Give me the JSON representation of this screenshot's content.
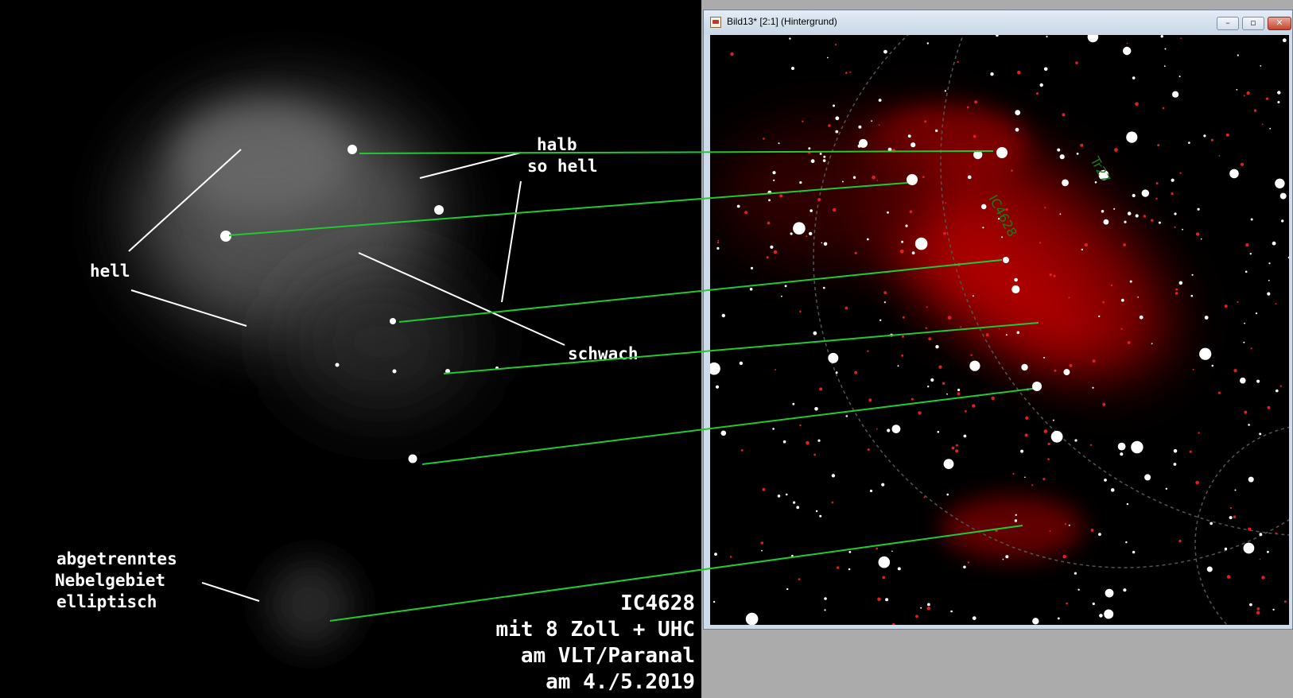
{
  "sketch": {
    "labels": {
      "halb": "halb",
      "so_hell": "so hell",
      "hell": "hell",
      "schwach": "schwach",
      "abgetrenntes": "abgetrenntes",
      "nebelgebiet": "Nebelgebiet",
      "elliptisch": "elliptisch"
    },
    "caption": [
      "IC4628",
      "mit 8 Zoll + UHC",
      "am VLT/Paranal",
      "am 4./5.2019"
    ]
  },
  "window": {
    "title": "Bild13* [2:1] (Hintergrund)",
    "buttons": {
      "minimize": "–",
      "maximize": "▫",
      "close": "✕"
    },
    "chart_labels": [
      "IC4628",
      "Tr27"
    ]
  },
  "colors": {
    "connector": "#22c832",
    "nebula": "#c80000",
    "chart_label": "#1e7a1e",
    "titlebar": "#cfdbe9",
    "desktop": "#ababab"
  },
  "icons": {
    "app": "picture-icon",
    "minimize": "minimize-icon",
    "maximize": "maximize-icon",
    "close": "close-icon"
  }
}
